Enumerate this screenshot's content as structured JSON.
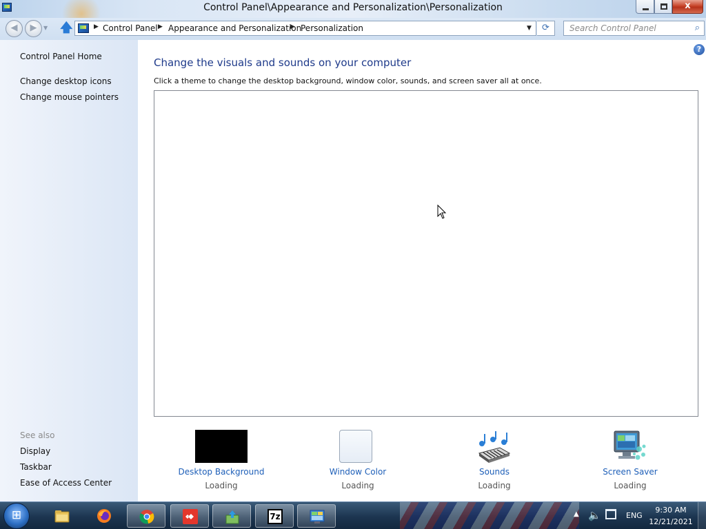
{
  "window": {
    "title": "Control Panel\\Appearance and Personalization\\Personalization",
    "close_glyph": "x"
  },
  "navigation": {
    "back_glyph": "◀",
    "forward_glyph": "▶",
    "up_glyph": "🡅",
    "breadcrumbs": [
      "Control Panel",
      "Appearance and Personalization",
      "Personalization"
    ],
    "breadcrumb_separator": "▶",
    "refresh_glyph": "⟳",
    "search_placeholder": "Search Control Panel"
  },
  "sidebar": {
    "home_link": "Control Panel Home",
    "task_links": [
      "Change desktop icons",
      "Change mouse pointers"
    ],
    "see_also_heading": "See also",
    "see_also_links": [
      "Display",
      "Taskbar",
      "Ease of Access Center"
    ]
  },
  "main": {
    "help_glyph": "?",
    "heading": "Change the visuals and sounds on your computer",
    "description": "Click a theme to change the desktop background, window color, sounds, and screen saver all at once.",
    "settings": [
      {
        "label": "Desktop Background",
        "status": "Loading",
        "icon": "desktop-background-thumbnail"
      },
      {
        "label": "Window Color",
        "status": "Loading",
        "icon": "window-color-icon"
      },
      {
        "label": "Sounds",
        "status": "Loading",
        "icon": "sounds-icon"
      },
      {
        "label": "Screen Saver",
        "status": "Loading",
        "icon": "screen-saver-icon"
      }
    ]
  },
  "taskbar": {
    "start_glyph": "⊞",
    "pinned_apps": [
      "file-explorer-icon",
      "firefox-icon",
      "chrome-icon",
      "anydesk-icon",
      "download-icon",
      "7zip-icon",
      "control-panel-icon"
    ],
    "sevenzip_label": "7z",
    "tray": {
      "arrow_glyph": "▲",
      "volume_glyph": "🔈",
      "language": "ENG",
      "time": "9:30 AM",
      "date": "12/21/2021"
    }
  },
  "colors": {
    "heading_blue": "#1e3a8a",
    "link_blue": "#1e5fb8",
    "close_red": "#c8462c"
  }
}
